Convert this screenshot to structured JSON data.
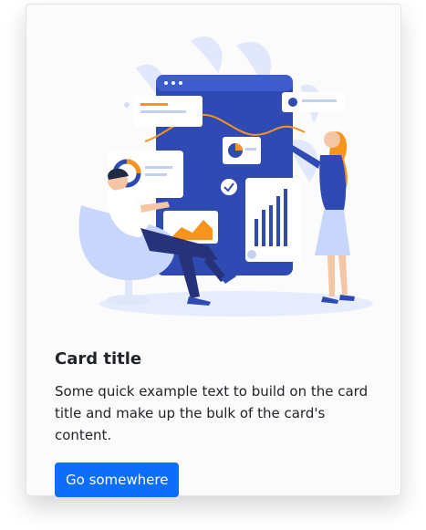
{
  "card": {
    "title": "Card title",
    "text": "Some quick example text to build on the card title and make up the bulk of the card's content.",
    "button_label": "Go somewhere"
  },
  "colors": {
    "accent": "#0d6efd",
    "illustration_blue": "#2f4bb3",
    "illustration_orange": "#f7941d"
  }
}
